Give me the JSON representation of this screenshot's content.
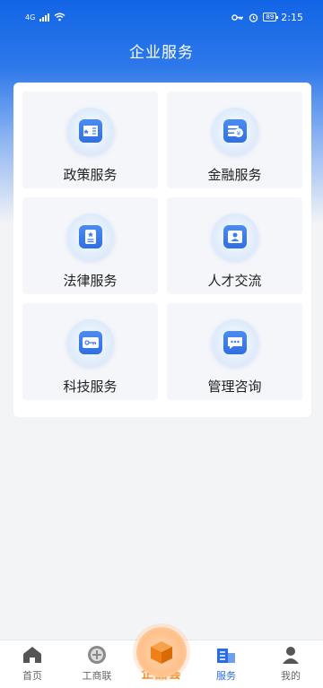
{
  "status_bar": {
    "network": "4G",
    "battery": "89",
    "time": "2:15"
  },
  "header": {
    "title": "企业服务"
  },
  "services": [
    {
      "label": "政策服务",
      "icon": "policy-book-icon"
    },
    {
      "label": "金融服务",
      "icon": "finance-coin-icon"
    },
    {
      "label": "法律服务",
      "icon": "law-document-icon"
    },
    {
      "label": "人才交流",
      "icon": "talent-person-icon"
    },
    {
      "label": "科技服务",
      "icon": "tech-connect-icon"
    },
    {
      "label": "管理咨询",
      "icon": "consult-chat-icon"
    }
  ],
  "tab_bar": {
    "home": "首页",
    "chamber": "工商联",
    "center": "企品荟",
    "services": "服务",
    "mine": "我的"
  },
  "colors": {
    "accent": "#2a6ce4",
    "header_gradient_top": "#1265e6",
    "center_label": "#f08a1c"
  }
}
